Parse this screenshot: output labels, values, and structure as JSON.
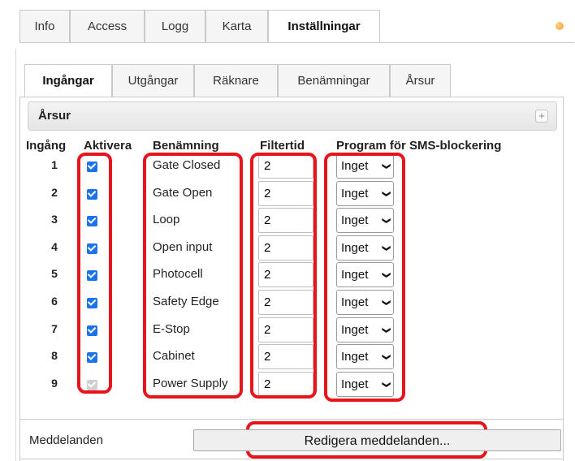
{
  "top_tabs": [
    "Info",
    "Access",
    "Logg",
    "Karta",
    "Inställningar"
  ],
  "inner_tabs": [
    "Ingångar",
    "Utgångar",
    "Räknare",
    "Benämningar",
    "Årsur"
  ],
  "section": {
    "title": "Årsur",
    "add_icon": "plus-icon",
    "add_label": "+"
  },
  "table": {
    "headers": {
      "input": "Ingång",
      "activate": "Aktivera",
      "name": "Benämning",
      "filter": "Filtertid",
      "program": "Program för SMS-blockering"
    },
    "rows": [
      {
        "num": "1",
        "active": true,
        "disabled": false,
        "name": "Gate Closed",
        "filter": "2",
        "program": "Inget"
      },
      {
        "num": "2",
        "active": true,
        "disabled": false,
        "name": "Gate Open",
        "filter": "2",
        "program": "Inget"
      },
      {
        "num": "3",
        "active": true,
        "disabled": false,
        "name": "Loop",
        "filter": "2",
        "program": "Inget"
      },
      {
        "num": "4",
        "active": true,
        "disabled": false,
        "name": "Open input",
        "filter": "2",
        "program": "Inget"
      },
      {
        "num": "5",
        "active": true,
        "disabled": false,
        "name": "Photocell",
        "filter": "2",
        "program": "Inget"
      },
      {
        "num": "6",
        "active": true,
        "disabled": false,
        "name": "Safety Edge",
        "filter": "2",
        "program": "Inget"
      },
      {
        "num": "7",
        "active": true,
        "disabled": false,
        "name": "E-Stop",
        "filter": "2",
        "program": "Inget"
      },
      {
        "num": "8",
        "active": true,
        "disabled": false,
        "name": "Cabinet",
        "filter": "2",
        "program": "Inget"
      },
      {
        "num": "9",
        "active": true,
        "disabled": true,
        "name": "Power Supply",
        "filter": "2",
        "program": "Inget"
      }
    ]
  },
  "messages": {
    "label": "Meddelanden",
    "button": "Redigera meddelanden..."
  },
  "colors": {
    "highlight": "#e8141c",
    "checkbox": "#1a73e8",
    "close_dot": "#f0a030"
  }
}
